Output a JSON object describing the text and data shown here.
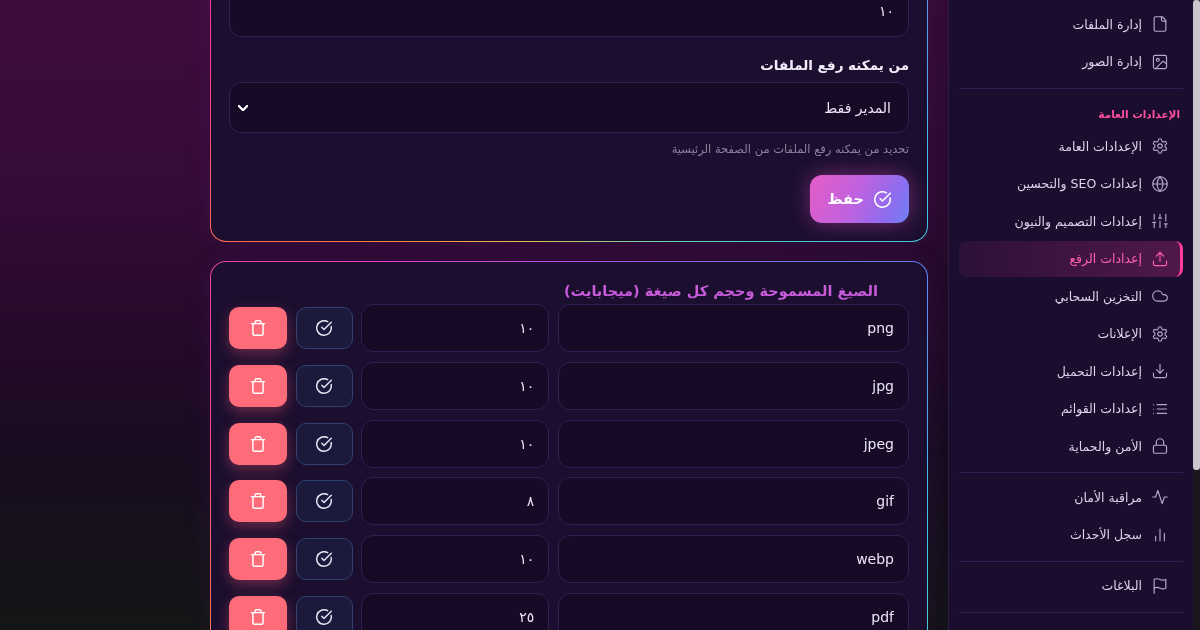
{
  "sidebar": {
    "groups": [
      {
        "items": [
          {
            "label": "إدارة الملفات",
            "selected": false
          },
          {
            "label": "إدارة الصور",
            "selected": false
          }
        ]
      },
      {
        "heading": "الإعدادات العامة",
        "items": [
          {
            "label": "الإعدادات العامة",
            "selected": false
          },
          {
            "label": "إعدادات SEO والتحسين",
            "selected": false
          },
          {
            "label": "إعدادات التصميم والنيون",
            "selected": false
          },
          {
            "label": "إعدادات الرفع",
            "selected": true
          },
          {
            "label": "التخزين السحابي",
            "selected": false
          },
          {
            "label": "الإعلانات",
            "selected": false
          },
          {
            "label": "إعدادات التحميل",
            "selected": false
          },
          {
            "label": "إعدادات القوائم",
            "selected": false
          },
          {
            "label": "الأمن والحماية",
            "selected": false
          }
        ]
      },
      {
        "items": [
          {
            "label": "مراقبة الأمان",
            "selected": false
          },
          {
            "label": "سجل الأحداث",
            "selected": false
          }
        ]
      },
      {
        "items": [
          {
            "label": "البلاغات",
            "selected": false
          }
        ]
      }
    ]
  },
  "upload_card": {
    "field": {
      "value": "١٠"
    },
    "permission_select": {
      "label": "من يمكنه رفع الملفات",
      "value": "المدير فقط",
      "hint": "تحديد من يمكنه رفع الملفات من الصفحة الرئيسية"
    },
    "save_button": {
      "label": "حفظ"
    }
  },
  "formats_card": {
    "title": "الصيغ المسموحة وحجم كل صيغة (ميجابايت)",
    "rows": [
      {
        "extension": "png",
        "size": "١٠"
      },
      {
        "extension": "jpg",
        "size": "١٠"
      },
      {
        "extension": "jpeg",
        "size": "١٠"
      },
      {
        "extension": "gif",
        "size": "٨"
      },
      {
        "extension": "webp",
        "size": "١٠"
      },
      {
        "extension": "pdf",
        "size": "٢٥"
      }
    ]
  }
}
